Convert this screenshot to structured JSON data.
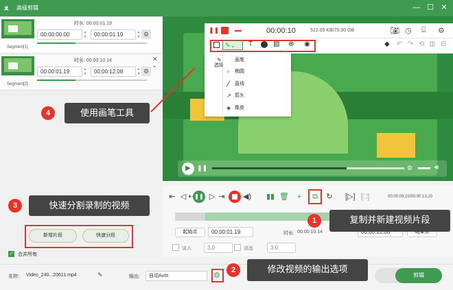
{
  "window": {
    "title": "高级剪辑",
    "minimize": "—",
    "maximize": "☐",
    "close": "✕"
  },
  "segments": [
    {
      "label": "Segment[1]",
      "duration_label": "时长: 00:00:01.19",
      "start": "00:00:00.00",
      "end": "00:00:01.19",
      "progress": 0.35
    },
    {
      "label": "Segment[2]",
      "duration_label": "时长: 00:00:10.14",
      "start": "00:00:01.19",
      "end": "00:00:12.08",
      "progress": 0.35
    }
  ],
  "recorder": {
    "time": "00:00:10",
    "storage": "512.05 KB/75.00 GB"
  },
  "draw_menu": {
    "header": "选择",
    "items": [
      {
        "label": "画笔",
        "icon": "✎"
      },
      {
        "label": "椭圆",
        "icon": "○"
      },
      {
        "label": "直线",
        "icon": "╱"
      },
      {
        "label": "箭头",
        "icon": "↗"
      },
      {
        "label": "橡皮",
        "icon": "◈"
      }
    ]
  },
  "callouts": {
    "c1": {
      "num": "1",
      "text": "复制并新建视频片段"
    },
    "c2": {
      "num": "2",
      "text": "修改视频的输出选项"
    },
    "c3": {
      "num": "3",
      "text": "快速分割录制的视频"
    },
    "c4": {
      "num": "4",
      "text": "使用画笔工具"
    }
  },
  "playback": {
    "time": "00:00:09.22/00:00:13.20"
  },
  "edit": {
    "start_btn": "起始点",
    "start_time": "00:00:01.19",
    "duration_label": "时长:",
    "duration_value": "00:00:10.14",
    "end_time": "00:00:12.08",
    "end_btn": "结束点",
    "fade_in": "淡入",
    "fade_in_value": "3.0",
    "fade_out": "淡出",
    "fade_out_value": "3.0"
  },
  "left_buttons": {
    "new_segment": "新增片段",
    "split": "快速分段",
    "merge_all": "合并所有"
  },
  "bottom": {
    "name_label": "名称:",
    "name_value": "Video_240...20611.mp4",
    "output_label": "输出:",
    "output_value": "自动Auto",
    "clip_button": "剪辑"
  },
  "colors": {
    "accent": "#3f9a52",
    "callout_red": "#e8332a",
    "callout_bg": "#444444"
  }
}
